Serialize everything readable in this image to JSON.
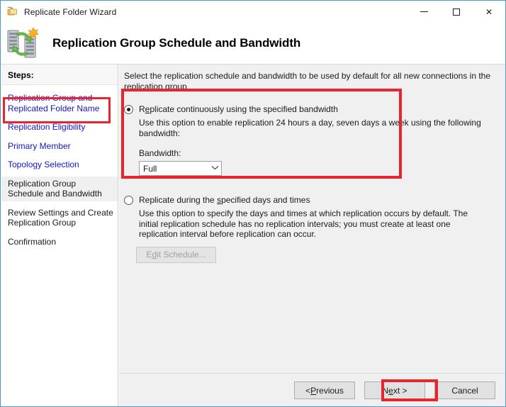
{
  "window": {
    "title": "Replicate Folder Wizard",
    "title_icon": "folder-replicate-icon",
    "controls": {
      "minimize": "minimize-icon",
      "maximize": "maximize-icon",
      "close": "close-icon"
    }
  },
  "header": {
    "icon": "dfs-replication-icon",
    "title": "Replication Group Schedule and Bandwidth"
  },
  "sidebar": {
    "heading": "Steps:",
    "items": [
      {
        "label": "Replication Group and Replicated Folder Name",
        "state": "link"
      },
      {
        "label": "Replication Eligibility",
        "state": "link"
      },
      {
        "label": "Primary Member",
        "state": "link"
      },
      {
        "label": "Topology Selection",
        "state": "link"
      },
      {
        "label": "Replication Group Schedule and Bandwidth",
        "state": "current"
      },
      {
        "label": "Review Settings and Create Replication Group",
        "state": "plain"
      },
      {
        "label": "Confirmation",
        "state": "plain"
      }
    ]
  },
  "main": {
    "intro": "Select the replication schedule and bandwidth to be used by default for all new connections in the replication group.",
    "option_continuous": {
      "label_pre": "R",
      "label_underline": "e",
      "label_post": "plicate continuously using the specified bandwidth",
      "label_full": "Replicate continuously using the specified bandwidth",
      "selected": true,
      "description": "Use this option to enable replication 24 hours a day, seven days a week using the following bandwidth:",
      "bandwidth_label": "Bandwidth:",
      "bandwidth_value": "Full"
    },
    "option_scheduled": {
      "label_pre": "Replicate during the ",
      "label_underline": "s",
      "label_post": "pecified days and times",
      "label_full": "Replicate during the specified days and times",
      "selected": false,
      "description": "Use this option to specify the days and times at which replication occurs by default. The initial replication schedule has no replication intervals; you must create at least one replication interval before replication can occur.",
      "edit_button_pre": "E",
      "edit_button_underline": "d",
      "edit_button_post": "it Schedule...",
      "edit_button_full": "Edit Schedule...",
      "edit_button_enabled": false
    }
  },
  "footer": {
    "previous": {
      "pre": "< ",
      "underline": "P",
      "post": "revious",
      "full": "< Previous"
    },
    "next": {
      "pre": "N",
      "underline": "e",
      "post": "xt >",
      "full": "Next >"
    },
    "cancel": {
      "full": "Cancel"
    }
  },
  "colors": {
    "highlight_red": "#e8252e",
    "link_blue": "#1414c8",
    "window_border": "#4a9bc8",
    "panel_bg": "#f0f0f0"
  }
}
